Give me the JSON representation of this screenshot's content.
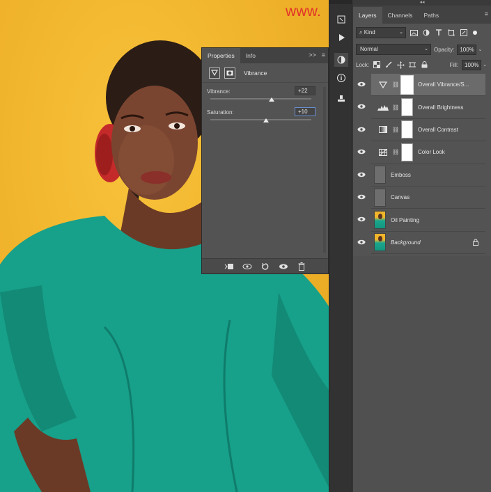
{
  "watermark": "www.",
  "properties": {
    "tabs": [
      {
        "label": "Properties"
      },
      {
        "label": "Info"
      }
    ],
    "expand_icon": ">>",
    "menu_icon": "≡",
    "adjustment_title": "Vibrance",
    "sliders": [
      {
        "label": "Vibrance:",
        "value": "+22",
        "position": 22
      },
      {
        "label": "Saturation:",
        "value": "+10",
        "position": 10
      }
    ]
  },
  "layers_panel": {
    "tabs": [
      {
        "label": "Layers"
      },
      {
        "label": "Channels"
      },
      {
        "label": "Paths"
      }
    ],
    "collapse_glyph": "◂◂",
    "filter_kind": "Kind",
    "blend_mode": "Normal",
    "opacity_label": "Opacity:",
    "opacity_value": "100%",
    "lock_label": "Lock:",
    "fill_label": "Fill:",
    "fill_value": "100%",
    "layers": [
      {
        "name": "Overall Vibrance/S...",
        "type": "vibrance",
        "selected": true
      },
      {
        "name": "Overall Brightness",
        "type": "levels",
        "selected": false
      },
      {
        "name": "Overall Contrast",
        "type": "gradient",
        "selected": false
      },
      {
        "name": "Color Look",
        "type": "lookup",
        "selected": false
      },
      {
        "name": "Emboss",
        "type": "gray",
        "selected": false
      },
      {
        "name": "Canvas",
        "type": "gray",
        "selected": false
      },
      {
        "name": "Oil Painting",
        "type": "photo",
        "selected": false
      },
      {
        "name": "Background",
        "type": "photo",
        "selected": false,
        "locked": true
      }
    ]
  },
  "colors": {
    "panel_bg": "#535353",
    "tab_bg": "#424242",
    "toolbar_bg": "#323232",
    "canvas_bg": "#efb22a",
    "shirt": "#17a08a",
    "watermark": "#e12a2a"
  }
}
